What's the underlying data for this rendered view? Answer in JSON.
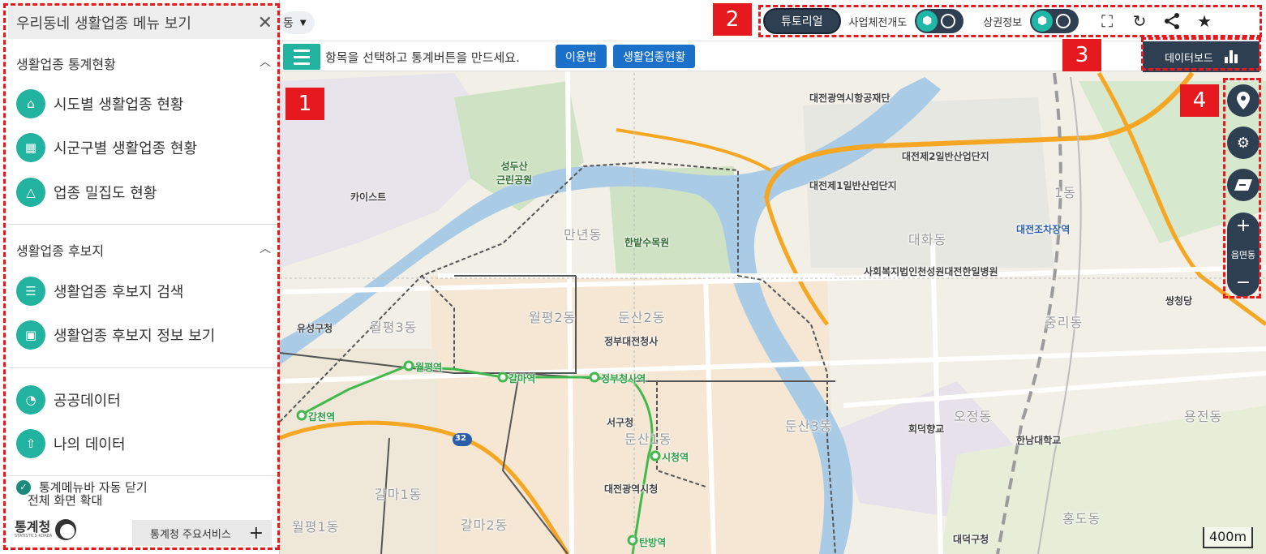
{
  "side_panel": {
    "header": "우리동네 생활업종 메뉴 보기",
    "section1": {
      "title": "생활업종 통계현황",
      "items": [
        {
          "label": "시도별 생활업종 현황",
          "icon": "map-icon"
        },
        {
          "label": "시군구별 생활업종 현황",
          "icon": "buildings-icon"
        },
        {
          "label": "업종 밀집도 현황",
          "icon": "density-icon"
        }
      ]
    },
    "section2": {
      "title": "생활업종 후보지",
      "items": [
        {
          "label": "생활업종 후보지 검색",
          "icon": "search-list-icon"
        },
        {
          "label": "생활업종 후보지 정보 보기",
          "icon": "info-board-icon"
        }
      ]
    },
    "section3": {
      "items": [
        {
          "label": "공공데이터",
          "icon": "pie-chart-icon"
        },
        {
          "label": "나의 데이터",
          "icon": "upload-icon"
        }
      ]
    },
    "auto_close": "통계메뉴바 자동 닫기",
    "fullscreen": "전체 화면 확대",
    "logo_text": "통계청",
    "logo_sub": "STATISTICS KOREA",
    "main_service": "통계청 주요서비스"
  },
  "top": {
    "region_suffix": "동",
    "tutorial": "튜토리얼",
    "business_label": "사업체전개도",
    "market_label": "상권정보"
  },
  "stat_bar": {
    "hint": "항목을 선택하고 통계버튼을 만드세요.",
    "usage_button": "이용법",
    "status_button": "생활업종현황",
    "dashboard_button": "데이터보드"
  },
  "zoom": {
    "level_label": "읍면동"
  },
  "scale": "400m",
  "annotations": [
    "1",
    "2",
    "3",
    "4"
  ],
  "map_labels": {
    "institute": "대전광역시항공재단",
    "industrial2": "대전제2일반산업단지",
    "industrial1": "대전제1일반산업단지",
    "kaist": "카이스트",
    "park1": "성두산\n근린공원",
    "mannyeon": "만년동",
    "hanbat": "한밭수목원",
    "daehwa": "대화동",
    "hospital": "사회복지법인천성원대전한일병원",
    "daejeon_station": "대전조차장역",
    "dong1": "1동",
    "yuseong": "유성구청",
    "wolpyeong3": "월평3동",
    "wolpyeong2": "월평2동",
    "dunsan2": "둔산2동",
    "gov_complex": "정부대전청사",
    "ssangcheong": "쌍청당",
    "jungri": "중리동",
    "wolpyeong_st": "월평역",
    "galma_st": "갈마역",
    "gov_st": "정부청사역",
    "gapcheon_st": "갑천역",
    "seogu": "서구청",
    "dunsan1": "둔산1동",
    "dunsan3": "둔산3동",
    "cityhall_st": "시청역",
    "hoedeok": "회덕향교",
    "ojeong": "오정동",
    "hannam": "한남대학교",
    "yongjeon": "용전동",
    "galma1": "갈마1동",
    "galma2": "갈마2동",
    "wolpyeong1": "월평1동",
    "cityhall": "대전광역시청",
    "tanbang_st": "탄방역",
    "hongdo": "홍도동",
    "daedeok": "대덕구청",
    "route": "32"
  },
  "colors": {
    "teal": "#21b39f",
    "navy": "#2e3f52",
    "blue": "#1b70c9",
    "annotation_red": "#e6191f",
    "river": "#a9cbe6",
    "highway": "#f5a623"
  }
}
